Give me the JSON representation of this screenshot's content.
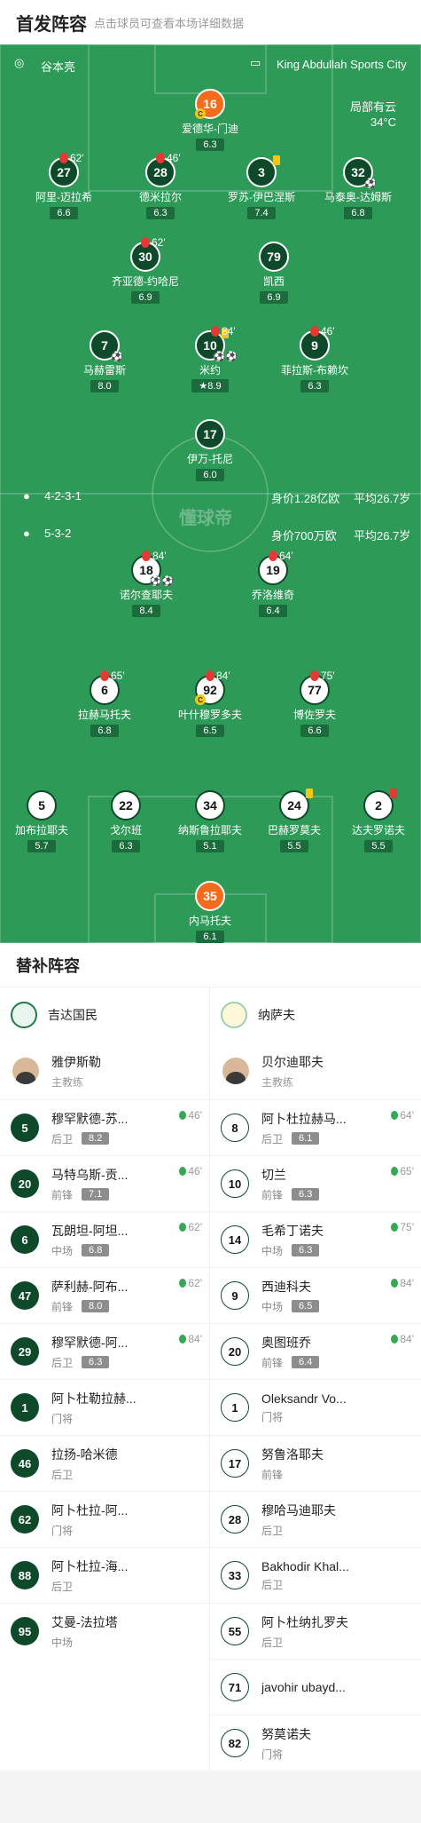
{
  "header": {
    "title": "首发阵容",
    "subtitle": "点击球员可查看本场详细数据"
  },
  "pitch_info": {
    "coach": "谷本亮",
    "stadium": "King Abdullah Sports City",
    "weather": "局部有云",
    "temp": "34°C",
    "home_formation": "4-2-3-1",
    "away_formation": "5-3-2",
    "home_value": "身价1.28亿欧",
    "home_age": "平均26.7岁",
    "away_value": "身价700万欧",
    "away_age": "平均26.7岁",
    "watermark": "懂球帝"
  },
  "home_players": [
    {
      "num": "16",
      "name": "爱德华-门迪",
      "rating": "6.3"
    },
    {
      "num": "27",
      "name": "阿里-迈拉希",
      "rating": "6.6",
      "sub": "62'"
    },
    {
      "num": "28",
      "name": "德米拉尔",
      "rating": "6.3",
      "sub": "46'"
    },
    {
      "num": "3",
      "name": "罗苏-伊巴涅斯",
      "rating": "7.4"
    },
    {
      "num": "32",
      "name": "马泰奥-达姆斯",
      "rating": "6.8"
    },
    {
      "num": "30",
      "name": "齐亚德-约哈尼",
      "rating": "6.9",
      "sub": "62'"
    },
    {
      "num": "79",
      "name": "凯西",
      "rating": "6.9"
    },
    {
      "num": "7",
      "name": "马赫雷斯",
      "rating": "8.0"
    },
    {
      "num": "10",
      "name": "米约",
      "rating": "8.9",
      "sub": "84'"
    },
    {
      "num": "9",
      "name": "菲拉斯-布赖坎",
      "rating": "6.3",
      "sub": "46'"
    },
    {
      "num": "17",
      "name": "伊万-托尼",
      "rating": "6.0"
    }
  ],
  "away_players": [
    {
      "num": "18",
      "name": "诺尔查耶夫",
      "rating": "8.4",
      "sub": "84'"
    },
    {
      "num": "19",
      "name": "乔洛维奇",
      "rating": "6.4",
      "sub": "64'"
    },
    {
      "num": "6",
      "name": "拉赫马托夫",
      "rating": "6.8",
      "sub": "65'"
    },
    {
      "num": "92",
      "name": "叶什穆罗多夫",
      "rating": "6.5",
      "sub": "84'"
    },
    {
      "num": "77",
      "name": "博佐罗夫",
      "rating": "6.6",
      "sub": "75'"
    },
    {
      "num": "5",
      "name": "加布拉耶夫",
      "rating": "5.7"
    },
    {
      "num": "22",
      "name": "戈尔班",
      "rating": "6.3"
    },
    {
      "num": "34",
      "name": "纳斯鲁拉耶夫",
      "rating": "5.1"
    },
    {
      "num": "24",
      "name": "巴赫罗莫夫",
      "rating": "5.5"
    },
    {
      "num": "2",
      "name": "达夫罗诺夫",
      "rating": "5.5"
    },
    {
      "num": "35",
      "name": "内马托夫",
      "rating": "6.1"
    }
  ],
  "subs": {
    "title": "替补阵容",
    "home": {
      "team": "吉达国民",
      "coach": "雅伊斯勒",
      "coach_role": "主教练",
      "players": [
        {
          "num": "5",
          "name": "穆罕默德-苏...",
          "pos": "后卫",
          "rating": "8.2",
          "ev": "46'"
        },
        {
          "num": "20",
          "name": "马特乌斯-贡...",
          "pos": "前锋",
          "rating": "7.1",
          "ev": "46'"
        },
        {
          "num": "6",
          "name": "瓦朗坦-阿坦...",
          "pos": "中场",
          "rating": "6.8",
          "ev": "62'"
        },
        {
          "num": "47",
          "name": "萨利赫-阿布...",
          "pos": "前锋",
          "rating": "8.0",
          "ev": "62'"
        },
        {
          "num": "29",
          "name": "穆罕默德-阿...",
          "pos": "后卫",
          "rating": "6.3",
          "ev": "84'"
        },
        {
          "num": "1",
          "name": "阿卜杜勒拉赫...",
          "pos": "门将"
        },
        {
          "num": "46",
          "name": "拉扬-哈米德",
          "pos": "后卫"
        },
        {
          "num": "62",
          "name": "阿卜杜拉-阿...",
          "pos": "门将"
        },
        {
          "num": "88",
          "name": "阿卜杜拉-海...",
          "pos": "后卫"
        },
        {
          "num": "95",
          "name": "艾曼-法拉塔",
          "pos": "中场"
        }
      ]
    },
    "away": {
      "team": "纳萨夫",
      "coach": "贝尔迪耶夫",
      "coach_role": "主教练",
      "players": [
        {
          "num": "8",
          "name": "阿卜杜拉赫马...",
          "pos": "后卫",
          "rating": "6.1",
          "ev": "64'"
        },
        {
          "num": "10",
          "name": "切兰",
          "pos": "前锋",
          "rating": "6.3",
          "ev": "65'"
        },
        {
          "num": "14",
          "name": "毛希丁诺夫",
          "pos": "中场",
          "rating": "6.3",
          "ev": "75'"
        },
        {
          "num": "9",
          "name": "西迪科夫",
          "pos": "中场",
          "rating": "6.5",
          "ev": "84'"
        },
        {
          "num": "20",
          "name": "奥图班乔",
          "pos": "前锋",
          "rating": "6.4",
          "ev": "84'"
        },
        {
          "num": "1",
          "name": "Oleksandr Vo...",
          "pos": "门将"
        },
        {
          "num": "17",
          "name": "努鲁洛耶夫",
          "pos": "前锋"
        },
        {
          "num": "28",
          "name": "穆哈马迪耶夫",
          "pos": "后卫"
        },
        {
          "num": "33",
          "name": "Bakhodir Khal...",
          "pos": "后卫"
        },
        {
          "num": "55",
          "name": "阿卜杜纳扎罗夫",
          "pos": "后卫"
        },
        {
          "num": "71",
          "name": "javohir ubayd..."
        },
        {
          "num": "82",
          "name": "努莫诺夫",
          "pos": "门将"
        }
      ]
    }
  },
  "colors": {
    "pitch": "#2d9a57",
    "home_circle": "#0e4a2a",
    "away_circle": "#ffffff",
    "gk": "#f46b1c"
  }
}
